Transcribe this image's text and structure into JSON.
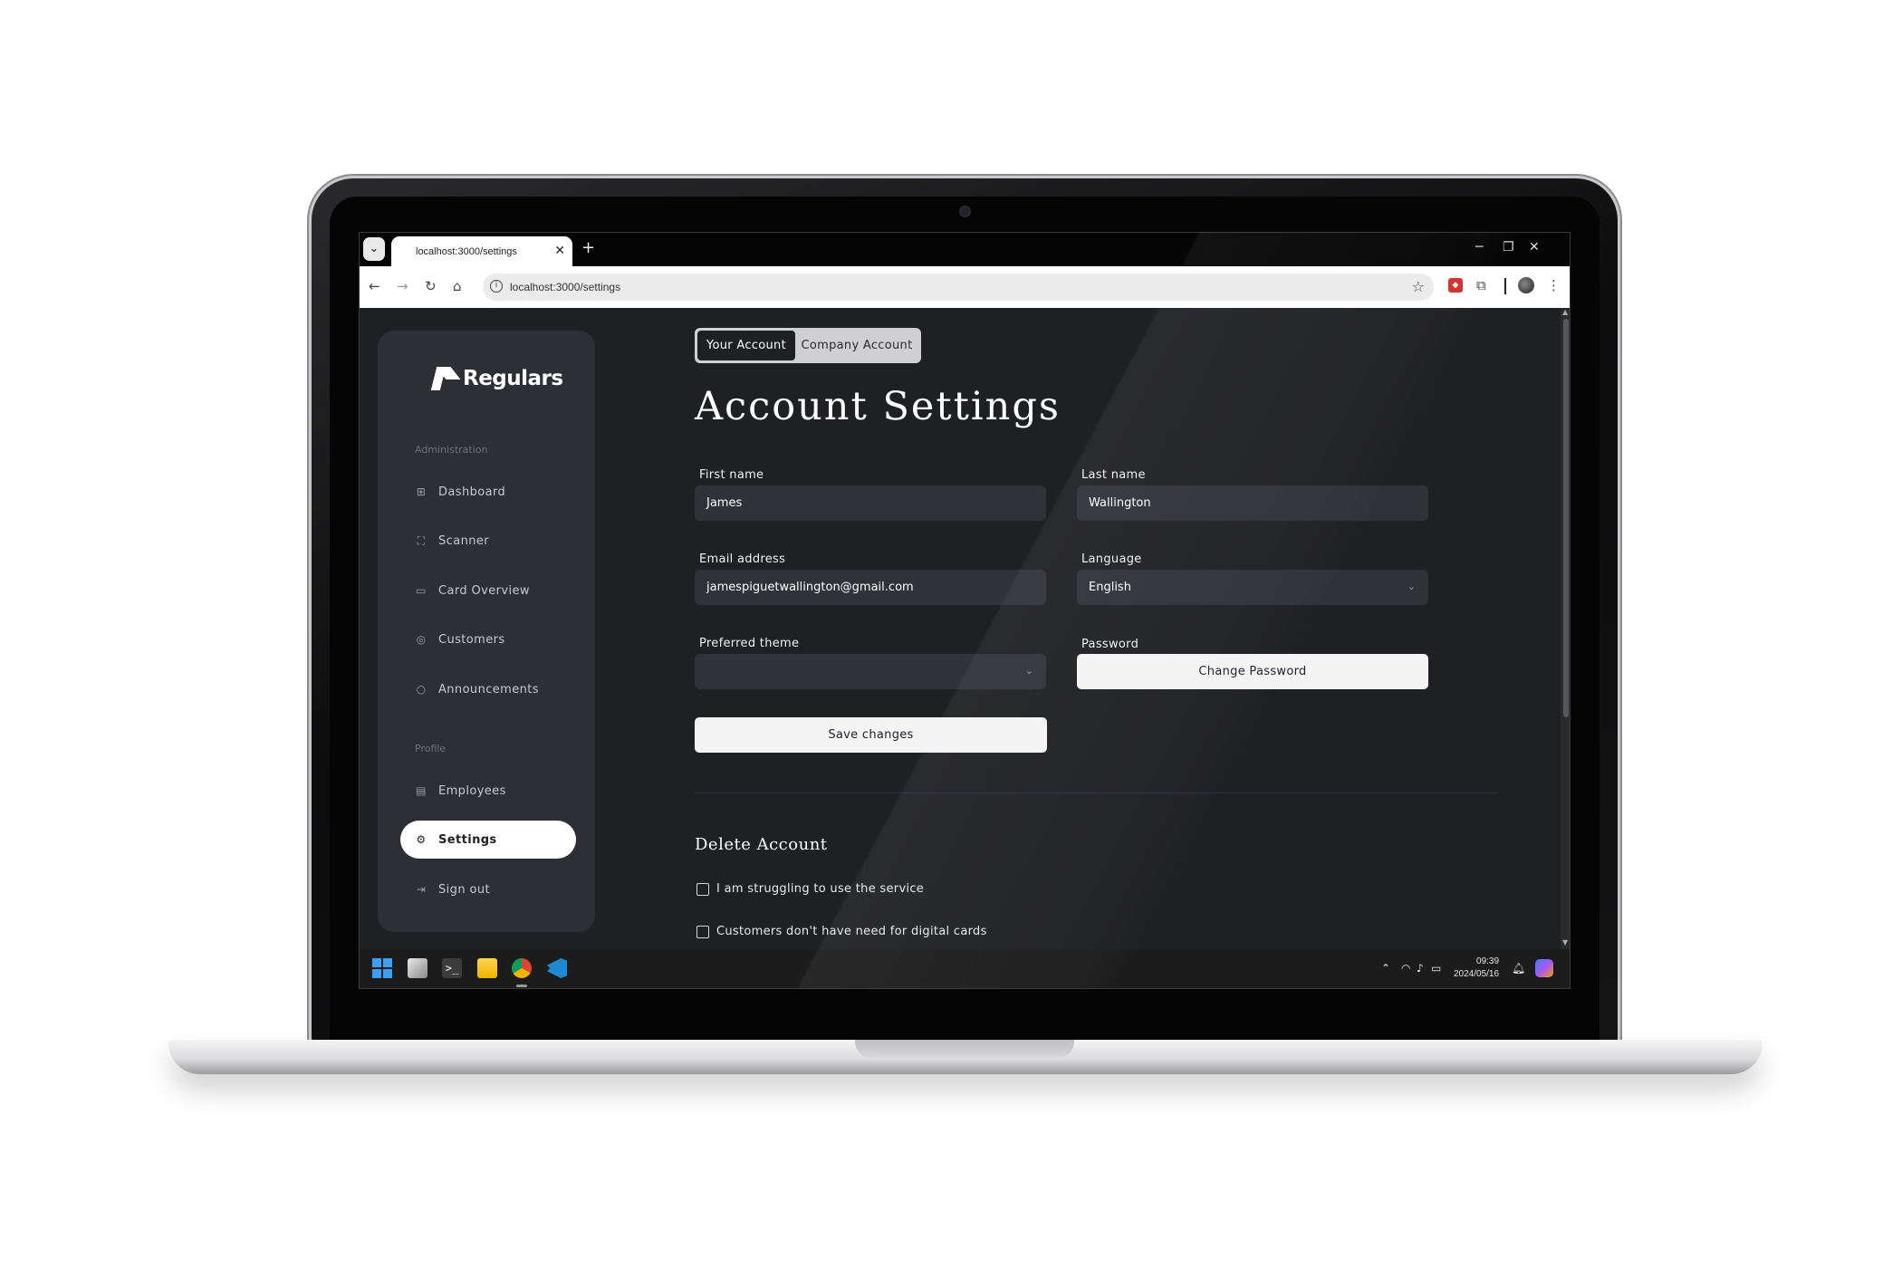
{
  "browser": {
    "tab_title": "localhost:3000/settings",
    "tab_close": "✕",
    "new_tab": "+",
    "url": "localhost:3000/settings",
    "win_controls": [
      "─",
      "❐",
      "✕"
    ]
  },
  "sidebar": {
    "brand": "Regulars",
    "sections": {
      "administration": "Administration",
      "profile": "Profile"
    },
    "admin_items": [
      {
        "label": "Dashboard",
        "icon": "grid-icon"
      },
      {
        "label": "Scanner",
        "icon": "scan-icon"
      },
      {
        "label": "Card Overview",
        "icon": "card-icon"
      },
      {
        "label": "Customers",
        "icon": "user-circle-icon"
      },
      {
        "label": "Announcements",
        "icon": "chat-bubble-icon"
      }
    ],
    "profile_items": [
      {
        "label": "Employees",
        "icon": "clipboard-icon"
      },
      {
        "label": "Settings",
        "icon": "gear-icon",
        "active": true
      },
      {
        "label": "Sign out",
        "icon": "sign-out-icon"
      }
    ]
  },
  "tabs": {
    "your_account": "Your Account",
    "company_account": "Company Account",
    "active": "Your Account"
  },
  "main": {
    "title": "Account Settings",
    "first_name": {
      "label": "First name",
      "value": "James"
    },
    "last_name": {
      "label": "Last name",
      "value": "Wallington"
    },
    "email": {
      "label": "Email address",
      "value": "jamespiguetwallington@gmail.com"
    },
    "language": {
      "label": "Language",
      "value": "English"
    },
    "theme": {
      "label": "Preferred theme",
      "value": ""
    },
    "password": {
      "label": "Password",
      "button": "Change Password"
    },
    "save_button": "Save changes"
  },
  "delete_account": {
    "title": "Delete Account",
    "reasons": [
      "I am struggling to use the service",
      "Customers don't have need for digital cards"
    ]
  },
  "taskbar": {
    "time": "09:39",
    "date": "2024/05/16"
  },
  "colors": {
    "page_bg": "#1f2024",
    "sidebar_bg": "#2d2f34",
    "input_bg": "#2f3237",
    "accent_white": "#ffffff"
  }
}
